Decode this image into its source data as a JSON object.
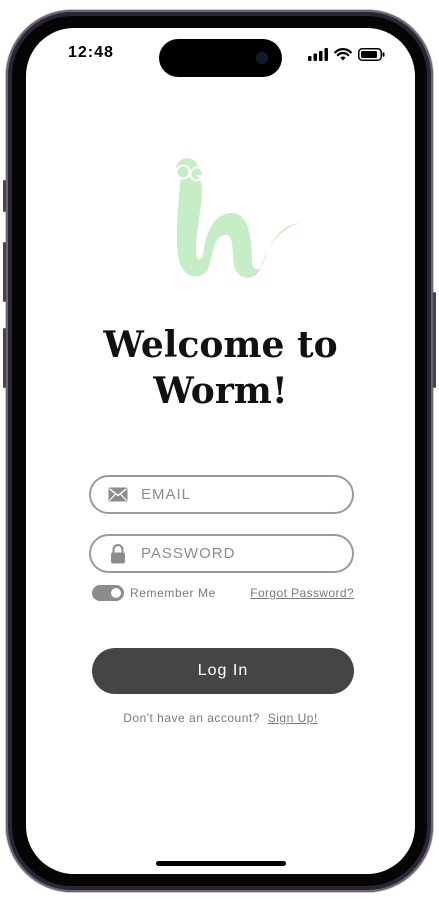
{
  "status_bar": {
    "time": "12:48"
  },
  "welcome": {
    "line1": "Welcome to",
    "line2": "Worm!"
  },
  "email": {
    "placeholder": "EMAIL",
    "value": ""
  },
  "password": {
    "placeholder": "PASSWORD",
    "value": ""
  },
  "options": {
    "remember_label": "Remember Me",
    "remember_on": true,
    "forgot_label": "Forgot Password?"
  },
  "login": {
    "label": "Log In"
  },
  "signup": {
    "prompt": "Don't have an account?",
    "link": "Sign Up!"
  },
  "icons": {
    "logo": "worm-logo-icon",
    "email": "envelope-icon",
    "password": "lock-icon",
    "signal": "cellular-signal-icon",
    "wifi": "wifi-icon",
    "battery": "battery-icon"
  },
  "colors": {
    "logo_green": "#c6edc5",
    "button_dark": "#454545",
    "field_border": "#9a9a9a",
    "muted_text": "#7a7a7a"
  }
}
